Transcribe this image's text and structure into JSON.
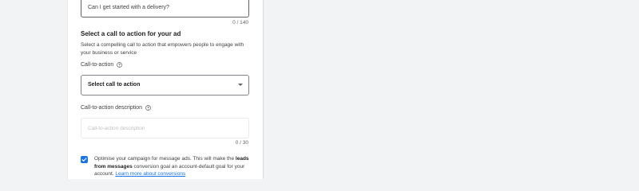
{
  "question_field": {
    "value": "Can I get started with a delivery?",
    "counter": "0 / 140"
  },
  "cta_section": {
    "title": "Select a call to action for your ad",
    "description": "Select a compelling call to action that empowers people to engage with your business or service",
    "cta_label": "Call-to-action",
    "cta_select_value": "Select call to action",
    "cta_description_label": "Call-to-action description",
    "cta_description_placeholder": "Call-to-action description",
    "cta_description_counter": "0 / 30"
  },
  "optimise_option": {
    "checked": true,
    "text_before": "Optimise your campaign for message ads. This will make the ",
    "bold_text": "leads from messages",
    "text_after": " conversion goal an account-default goal for your account. ",
    "link_text": "Learn more about conversions"
  },
  "icons": {
    "help": "help-circle-icon",
    "dropdown": "chevron-down-icon",
    "check": "check-icon"
  },
  "colors": {
    "accent": "#1a73e8",
    "page_background": "#f1f3f4",
    "panel_background": "#ffffff"
  }
}
